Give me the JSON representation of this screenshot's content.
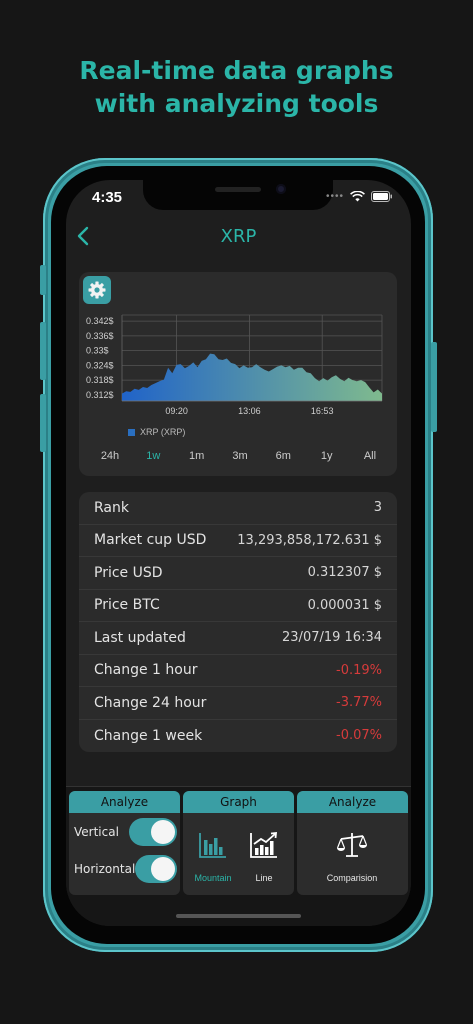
{
  "promo": {
    "line1": "Real-time data graphs",
    "line2": "with analyzing tools"
  },
  "status_bar": {
    "time": "4:35"
  },
  "nav": {
    "title": "XRP",
    "back_icon": "chevron-left-icon"
  },
  "chart": {
    "settings_icon": "gear-icon",
    "legend": "XRP (XRP)",
    "ranges": [
      {
        "label": "24h",
        "active": false
      },
      {
        "label": "1w",
        "active": true
      },
      {
        "label": "1m",
        "active": false
      },
      {
        "label": "3m",
        "active": false
      },
      {
        "label": "6m",
        "active": false
      },
      {
        "label": "1y",
        "active": false
      },
      {
        "label": "All",
        "active": false
      }
    ]
  },
  "chart_data": {
    "type": "area",
    "series": [
      {
        "name": "XRP (XRP)",
        "values": [
          0.3125,
          0.3135,
          0.3132,
          0.3145,
          0.314,
          0.3152,
          0.3148,
          0.316,
          0.3168,
          0.3176,
          0.3182,
          0.323,
          0.3208,
          0.3242,
          0.3245,
          0.3228,
          0.3238,
          0.3252,
          0.3232,
          0.3258,
          0.3265,
          0.3288,
          0.3285,
          0.3265,
          0.3262,
          0.3268,
          0.325,
          0.3245,
          0.3228,
          0.324,
          0.323,
          0.3232,
          0.3245,
          0.3232,
          0.3222,
          0.3215,
          0.3225,
          0.3235,
          0.324,
          0.3232,
          0.3238,
          0.3222,
          0.323,
          0.323,
          0.3212,
          0.3208,
          0.3188,
          0.3175,
          0.3188,
          0.3178,
          0.3192,
          0.32,
          0.3185,
          0.3175,
          0.319,
          0.318,
          0.3175,
          0.318,
          0.3172,
          0.315,
          0.313,
          0.3142,
          0.3125
        ]
      }
    ],
    "x_ticks": [
      "09:20",
      "13:06",
      "16:53"
    ],
    "y_ticks": [
      "0.312$",
      "0.318$",
      "0.324$",
      "0.33$",
      "0.336$",
      "0.342$"
    ],
    "ylim": [
      0.3095,
      0.3445
    ],
    "grid": true,
    "colors": {
      "start": "#2063c9",
      "end": "#7fba8e"
    }
  },
  "info": {
    "rows": [
      {
        "label": "Rank",
        "value": "3",
        "negative": false
      },
      {
        "label": "Market cup USD",
        "value": "13,293,858,172.631 $",
        "negative": false
      },
      {
        "label": "Price USD",
        "value": "0.312307 $",
        "negative": false
      },
      {
        "label": "Price BTC",
        "value": "0.000031 $",
        "negative": false
      },
      {
        "label": "Last updated",
        "value": "23/07/19 16:34",
        "negative": false
      },
      {
        "label": "Change 1 hour",
        "value": "-0.19%",
        "negative": true
      },
      {
        "label": "Change 24 hour",
        "value": "-3.77%",
        "negative": true
      },
      {
        "label": "Change 1 week",
        "value": "-0.07%",
        "negative": true
      }
    ]
  },
  "toolbar": {
    "analyze_panel": {
      "title": "Analyze",
      "vertical_label": "Vertical",
      "vertical_on": true,
      "horizontal_label": "Horizontal",
      "horizontal_on": true
    },
    "graph_panel": {
      "title": "Graph",
      "mountain_label": "Mountain",
      "line_label": "Line",
      "selected": "Mountain"
    },
    "compare_panel": {
      "title": "Analyze",
      "comparison_label": "Comparision"
    }
  },
  "colors": {
    "accent": "#3a9ea4",
    "accent_text": "#2bb5a8",
    "negative": "#d63b3b"
  }
}
